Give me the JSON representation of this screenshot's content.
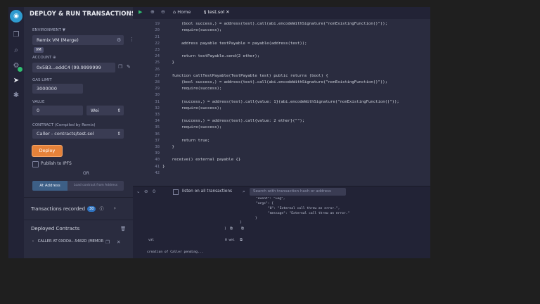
{
  "rail": {
    "icons": [
      "remix-logo-icon",
      "file-explorer-icon",
      "search-icon",
      "compiler-icon",
      "deploy-run-icon",
      "debugger-icon"
    ]
  },
  "panel": {
    "title": "DEPLOY & RUN TRANSACTIONS",
    "environment_label": "ENVIRONMENT",
    "environment_value": "Remix VM (Merge)",
    "vm_badge": "VM",
    "account_label": "ACCOUNT",
    "account_value": "0x5B3...eddC4 (99.9999999",
    "gas_limit_label": "GAS LIMIT",
    "gas_limit_value": "3000000",
    "value_label": "VALUE",
    "value_amount": "0",
    "value_unit": "Wei",
    "contract_label": "CONTRACT",
    "contract_note": "(Compiled by Remix)",
    "contract_value": "Caller - contracts/test.sol",
    "deploy_label": "Deploy",
    "publish_label": "Publish to IPFS",
    "or_label": "OR",
    "at_address_label": "At Address",
    "load_contract_label": "Load contract from Address",
    "tx_recorded_label": "Transactions recorded",
    "tx_recorded_count": "30",
    "deployed_label": "Deployed Contracts",
    "instance_label": "CALLER AT 0XDDA...5482D (MEMOR"
  },
  "tabs": {
    "home": "Home",
    "file": "test.sol"
  },
  "editor": {
    "lines": [
      {
        "n": "18",
        "t": ""
      },
      {
        "n": "19",
        "t": "        (bool success,) = address(test).call(abi.encodeWithSignature(\"nonExistingFunction()\"));"
      },
      {
        "n": "20",
        "t": "        require(success);"
      },
      {
        "n": "21",
        "t": ""
      },
      {
        "n": "22",
        "t": "        address payable testPayable = payable(address(test));"
      },
      {
        "n": "23",
        "t": ""
      },
      {
        "n": "24",
        "t": "        return testPayable.send(2 ether);"
      },
      {
        "n": "25",
        "t": "    }"
      },
      {
        "n": "26",
        "t": ""
      },
      {
        "n": "27",
        "t": "    function callTestPayable(TestPayable test) public returns (bool) {"
      },
      {
        "n": "28",
        "t": "        (bool success,) = address(test).call(abi.encodeWithSignature(\"nonExistingFunction()\"));"
      },
      {
        "n": "29",
        "t": "        require(success);"
      },
      {
        "n": "30",
        "t": ""
      },
      {
        "n": "31",
        "t": "        (success,) = address(test).call{value: 1}(abi.encodeWithSignature(\"nonExistingFunction()\"));"
      },
      {
        "n": "32",
        "t": "        require(success);"
      },
      {
        "n": "33",
        "t": ""
      },
      {
        "n": "34",
        "t": "        (success,) = address(test).call{value: 2 ether}(\"\");"
      },
      {
        "n": "35",
        "t": "        require(success);"
      },
      {
        "n": "36",
        "t": ""
      },
      {
        "n": "37",
        "t": "        return true;"
      },
      {
        "n": "38",
        "t": "    }"
      },
      {
        "n": "39",
        "t": ""
      },
      {
        "n": "40",
        "t": "    receive() external payable {}"
      },
      {
        "n": "41",
        "t": "}"
      },
      {
        "n": "42",
        "t": ""
      }
    ]
  },
  "terminal": {
    "listen_label": "listen on all transactions",
    "search_placeholder": "Search with transaction hash or address",
    "lines": [
      "\"event\": \"Log\",",
      "\"args\": {",
      "\"0\": \"External call threw an error.\",",
      "\"message\": \"External call threw an error.\"",
      "}",
      "}",
      "]",
      "val",
      "0 wei",
      "creation of Caller pending..."
    ]
  },
  "colors": {
    "accent": "#e5823a",
    "success": "#2fbf71",
    "panel_bg": "#2a2c3f"
  }
}
